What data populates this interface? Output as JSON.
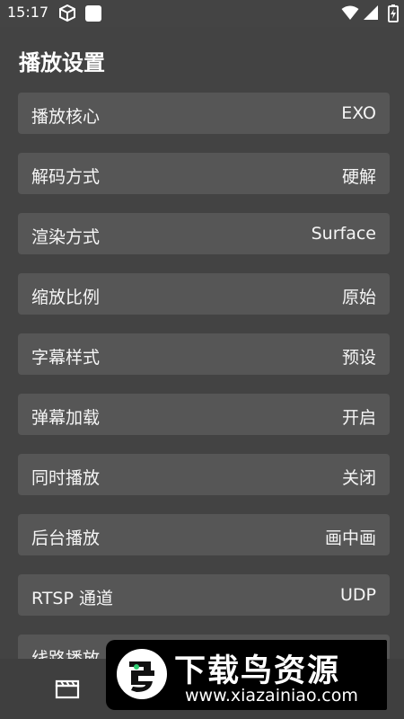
{
  "status_bar": {
    "time": "15:17",
    "icons": [
      "cube-icon",
      "square-icon",
      "wifi-icon",
      "signal-icon",
      "battery-charging-icon"
    ]
  },
  "page": {
    "title": "播放设置"
  },
  "settings": [
    {
      "label": "播放核心",
      "value": "EXO"
    },
    {
      "label": "解码方式",
      "value": "硬解"
    },
    {
      "label": "渲染方式",
      "value": "Surface"
    },
    {
      "label": "缩放比例",
      "value": "原始"
    },
    {
      "label": "字幕样式",
      "value": "预设"
    },
    {
      "label": "弹幕加载",
      "value": "开启"
    },
    {
      "label": "同时播放",
      "value": "关闭"
    },
    {
      "label": "后台播放",
      "value": "画中画"
    },
    {
      "label": "RTSP 通道",
      "value": "UDP"
    },
    {
      "label": "线路播放",
      "value": ""
    }
  ],
  "bottom_nav": {
    "icons": [
      "clapperboard-icon"
    ]
  },
  "watermark": {
    "title": "下载鸟资源",
    "url": "www.xiazainiao.com"
  },
  "colors": {
    "background": "#434343",
    "row": "#565656",
    "text": "#ffffff",
    "watermark_bg": "#000000",
    "logo_accent": "#2ecc71"
  }
}
